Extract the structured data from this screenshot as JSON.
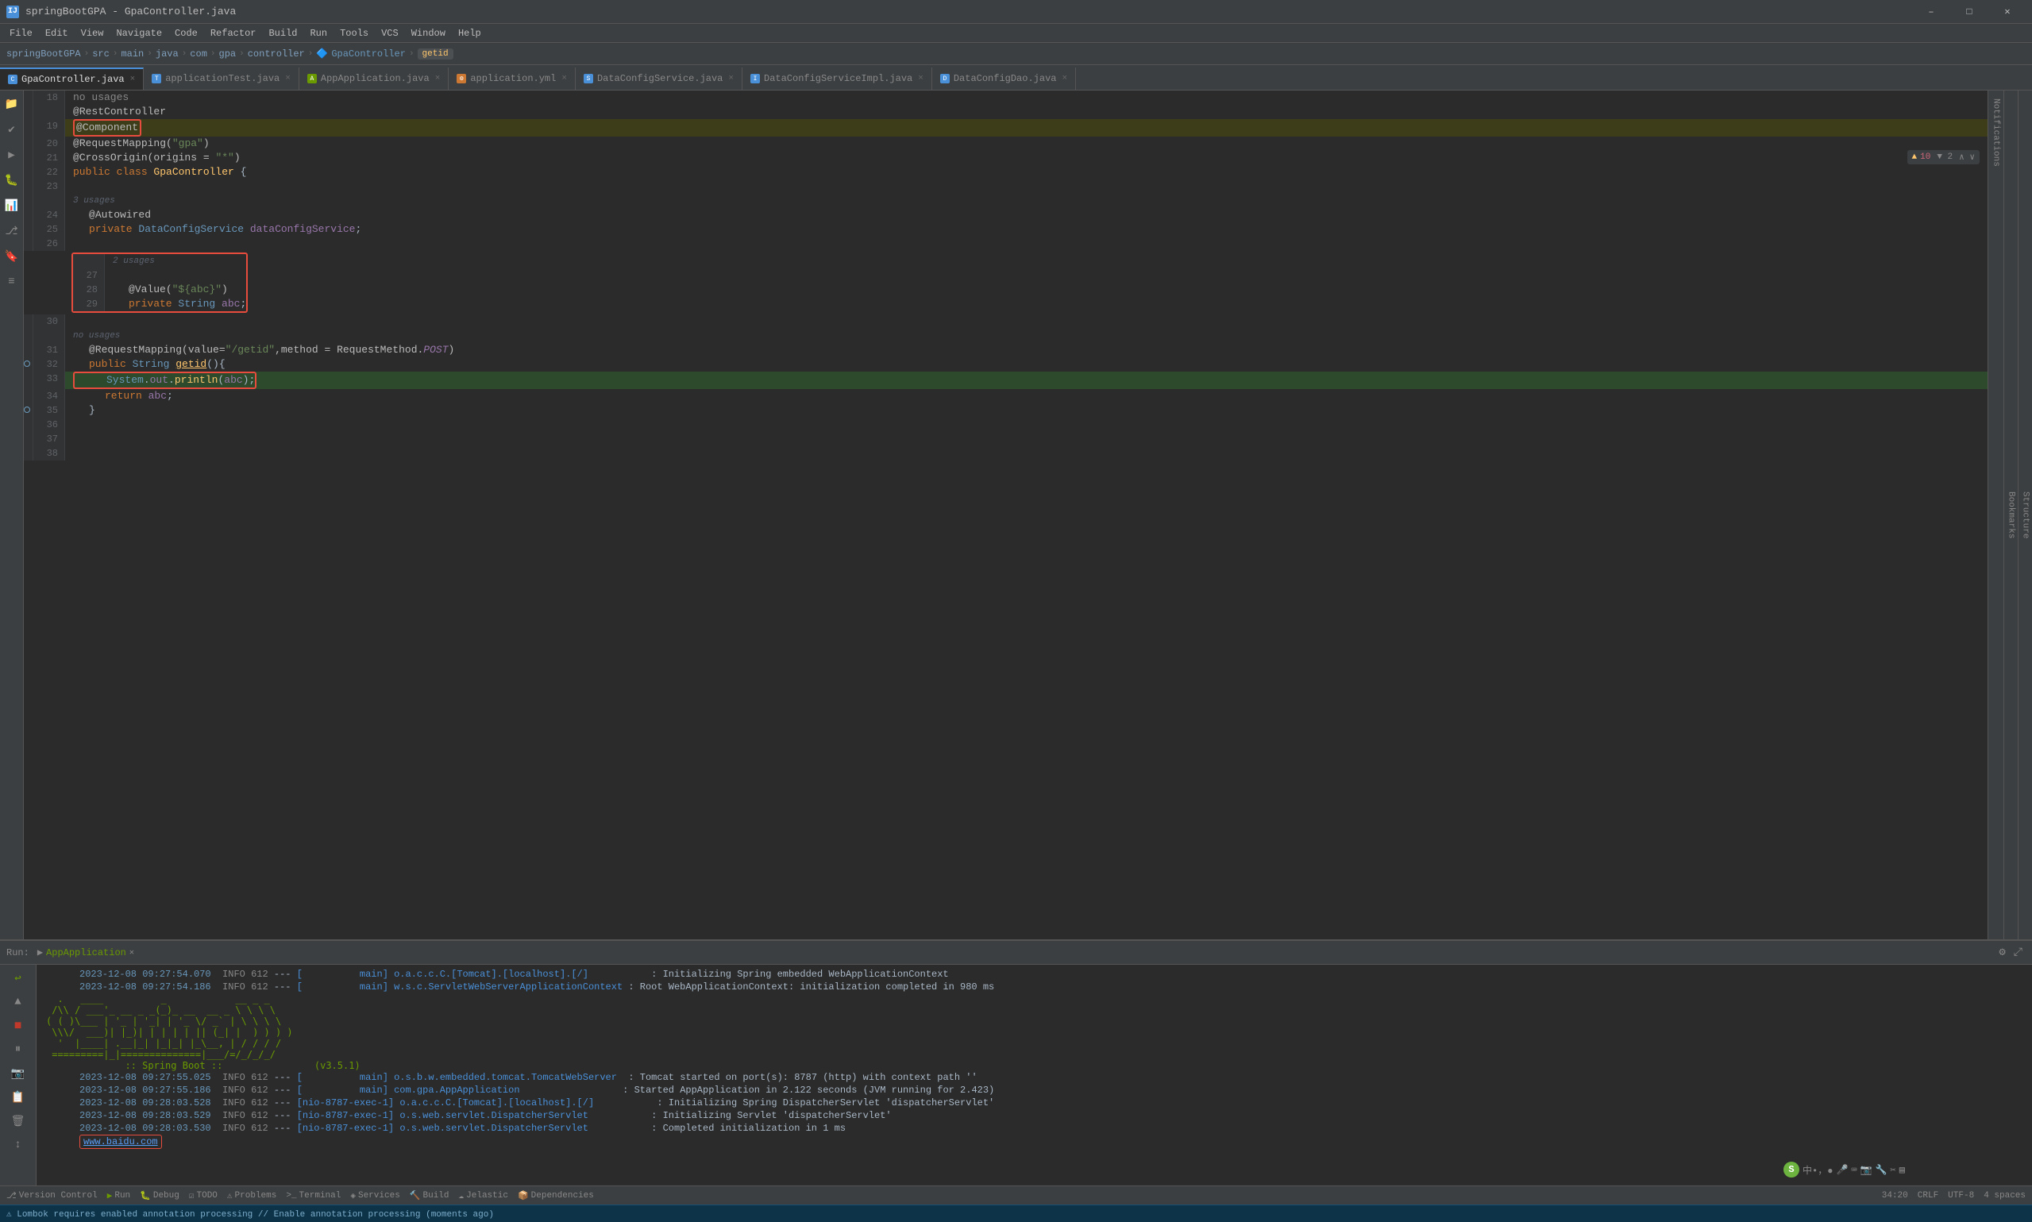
{
  "window": {
    "title": "springBootGPA - GpaController.java",
    "icon": "IJ"
  },
  "menubar": {
    "items": [
      "File",
      "Edit",
      "View",
      "Navigate",
      "Code",
      "Refactor",
      "Build",
      "Run",
      "Tools",
      "VCS",
      "Window",
      "Help"
    ]
  },
  "breadcrumb": {
    "items": [
      "springBootGPA",
      "src",
      "main",
      "java",
      "com",
      "gpa",
      "controller"
    ],
    "file": "GpaController",
    "method": "getid"
  },
  "tabs": [
    {
      "label": "GpaController.java",
      "type": "controller",
      "active": true
    },
    {
      "label": "applicationTest.java",
      "type": "test",
      "active": false
    },
    {
      "label": "AppApplication.java",
      "type": "app",
      "active": false
    },
    {
      "label": "application.yml",
      "type": "config",
      "active": false
    },
    {
      "label": "DataConfigService.java",
      "type": "service",
      "active": false
    },
    {
      "label": "DataConfigServiceImpl.java",
      "type": "impl",
      "active": false
    },
    {
      "label": "DataConfigDao.java",
      "type": "dao",
      "active": false
    }
  ],
  "code": {
    "lines": [
      {
        "num": 18,
        "content": "    @RestController",
        "type": "annotation"
      },
      {
        "num": 19,
        "content": "    @Component",
        "type": "annotation-highlight"
      },
      {
        "num": 20,
        "content": "    @RequestMapping(\"gpa\")",
        "type": "annotation"
      },
      {
        "num": 21,
        "content": "    @CrossOrigin(origins = \"*\")",
        "type": "annotation"
      },
      {
        "num": 22,
        "content": "    public class GpaController {",
        "type": "code"
      },
      {
        "num": 23,
        "content": "",
        "type": "empty"
      },
      {
        "num": 24,
        "content": "        @Autowired",
        "type": "annotation"
      },
      {
        "num": 25,
        "content": "        private DataConfigService dataConfigService;",
        "type": "code"
      },
      {
        "num": 26,
        "content": "",
        "type": "empty"
      },
      {
        "num": 27,
        "content": "",
        "type": "empty"
      },
      {
        "num": 28,
        "content": "        @Value(\"${abc}\")",
        "type": "annotation"
      },
      {
        "num": 29,
        "content": "        private String abc;",
        "type": "code"
      },
      {
        "num": 30,
        "content": "",
        "type": "empty"
      },
      {
        "num": 31,
        "content": "        @RequestMapping(value=\"/getid\",method = RequestMethod.POST)",
        "type": "annotation"
      },
      {
        "num": 32,
        "content": "        public String getid(){",
        "type": "code"
      },
      {
        "num": 33,
        "content": "            System.out.println(abc);",
        "type": "code-highlight"
      },
      {
        "num": 34,
        "content": "            return abc;",
        "type": "code"
      },
      {
        "num": 35,
        "content": "        }",
        "type": "code"
      },
      {
        "num": 36,
        "content": "",
        "type": "empty"
      },
      {
        "num": 37,
        "content": "",
        "type": "empty"
      },
      {
        "num": 38,
        "content": "",
        "type": "empty"
      }
    ]
  },
  "run_panel": {
    "header": {
      "run_label": "Run:",
      "app_name": "AppApplication",
      "tabs": [
        "Run",
        "Debug",
        "TODO",
        "Problems",
        "Terminal",
        "Services",
        "Build",
        "Jelastic",
        "Dependencies"
      ]
    },
    "logs": [
      {
        "time": "2023-12-08 09:27:54.070",
        "level": "INFO",
        "pid": "612",
        "sep": "---",
        "thread": "[          main]",
        "source": "o.a.c.c.C.[Tomcat].[localhost].[/]",
        "colon": ":",
        "message": "Initializing Spring embedded WebApplicationContext"
      },
      {
        "time": "2023-12-08 09:27:54.186",
        "level": "INFO",
        "pid": "612",
        "sep": "---",
        "thread": "[          main]",
        "source": "w.s.c.ServletWebServerApplicationContext",
        "colon": ":",
        "message": "Root WebApplicationContext: initialization completed in 980 ms"
      },
      {
        "ascii": true,
        "content": "  .   ____          _            __ _ _\n /\\\\ / ___'_ __ _ _(_)_ __  __ _ \\ \\ \\ \\\n( ( )\\___ | '_ | '_| | '_ \\/ _` | \\ \\ \\ \\\n \\\\/  ___)| |_)| | | | | || (_| |  ) ) ) )\n  '  |____| .__|_| |_|_| |_\\__, | / / / /\n =========|_|==============|___/=/_/_/_/"
      },
      {
        "ascii_version": " :: Spring Boot ::                (v3.5.1)"
      },
      {
        "time": "2023-12-08 09:27:55.025",
        "level": "INFO",
        "pid": "612",
        "sep": "---",
        "thread": "[          main]",
        "source": "o.s.b.w.embedded.tomcat.TomcatWebServer",
        "colon": ":",
        "message": "Tomcat started on port(s): 8787 (http) with context path ''"
      },
      {
        "time": "2023-12-08 09:27:55.186",
        "level": "INFO",
        "pid": "612",
        "sep": "---",
        "thread": "[          main]",
        "source": "com.gpa.AppApplication",
        "colon": ":",
        "message": "Started AppApplication in 2.122 seconds (JVM running for 2.423)"
      },
      {
        "time": "2023-12-08 09:28:03.528",
        "level": "INFO",
        "pid": "612",
        "sep": "---",
        "thread": "[nio-8787-exec-1]",
        "source": "o.a.c.c.C.[Tomcat].[localhost].[/]",
        "colon": ":",
        "message": "Initializing Spring DispatcherServlet 'dispatcherServlet'"
      },
      {
        "time": "2023-12-08 09:28:03.529",
        "level": "INFO",
        "pid": "612",
        "sep": "---",
        "thread": "[nio-8787-exec-1]",
        "source": "o.s.web.servlet.DispatcherServlet",
        "colon": ":",
        "message": "Initializing Servlet 'dispatcherServlet'"
      },
      {
        "time": "2023-12-08 09:28:03.530",
        "level": "INFO",
        "pid": "612",
        "sep": "---",
        "thread": "[nio-8787-exec-1]",
        "source": "o.s.web.servlet.DispatcherServlet",
        "colon": ":",
        "message": "Completed initialization in 1 ms"
      },
      {
        "url": "www.baidu.com"
      }
    ]
  },
  "statusbar": {
    "version_control": "Version Control",
    "run": "Run",
    "debug": "Debug",
    "todo": "TODO",
    "problems": "Problems",
    "terminal": "Terminal",
    "services": "Services",
    "build": "Build",
    "jelastic": "Jelastic",
    "dependencies": "Dependencies",
    "position": "34:20",
    "encoding": "CRLF",
    "charset": "UTF-8",
    "indent": "4 spaces"
  },
  "bottom_notification": {
    "message": "⚠ Lombok requires enabled annotation processing // Enable annotation processing (moments ago)"
  },
  "error_indicator": {
    "count": "▲ 10",
    "warnings": "▼ 2"
  }
}
